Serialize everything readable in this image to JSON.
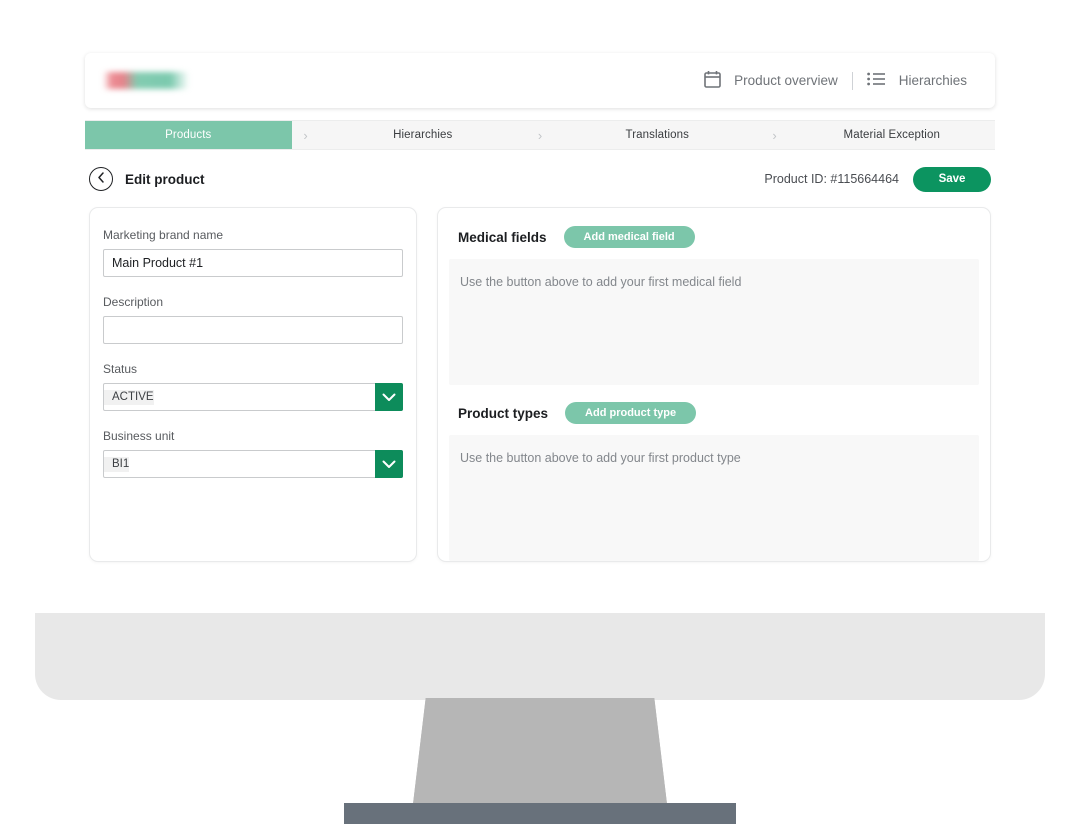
{
  "top_bar": {
    "logo_alt": "company-logo-redacted",
    "links": [
      {
        "icon": "calendar-icon",
        "label": "Product overview"
      },
      {
        "icon": "list-icon",
        "label": "Hierarchies"
      }
    ]
  },
  "tabs": [
    {
      "label": "Products",
      "active": true
    },
    {
      "label": "Hierarchies",
      "active": false
    },
    {
      "label": "Translations",
      "active": false
    },
    {
      "label": "Material Exception",
      "active": false
    }
  ],
  "tab_separator": "›",
  "page_header": {
    "back_icon": "chevron-left-circle-icon",
    "title": "Edit product",
    "product_id": "Product ID: #115664464",
    "save_label": "Save"
  },
  "form": {
    "fields": [
      {
        "label": "Marketing brand name",
        "type": "text",
        "value": "Main Product #1",
        "placeholder": ""
      },
      {
        "label": "Description",
        "type": "text",
        "value": "",
        "placeholder": ""
      },
      {
        "label": "Status",
        "type": "select",
        "value": "ACTIVE",
        "options": [
          "ACTIVE"
        ]
      },
      {
        "label": "Business unit",
        "type": "select",
        "value": "BI1",
        "options": [
          "BI1"
        ]
      }
    ]
  },
  "panels": [
    {
      "title": "Medical fields",
      "button_label": "Add medical field",
      "empty_text": "Use the button above to add your first medical field"
    },
    {
      "title": "Product types",
      "button_label": "Add product type",
      "empty_text": "Use the button above to add your first product type"
    }
  ],
  "colors": {
    "accent_mint": "#7cc6aa",
    "accent_green": "#0c9460",
    "select_green": "#0d8c5b",
    "monitor_body": "#e8e8e8",
    "monitor_neck": "#b6b6b6",
    "monitor_foot": "#68717b"
  }
}
